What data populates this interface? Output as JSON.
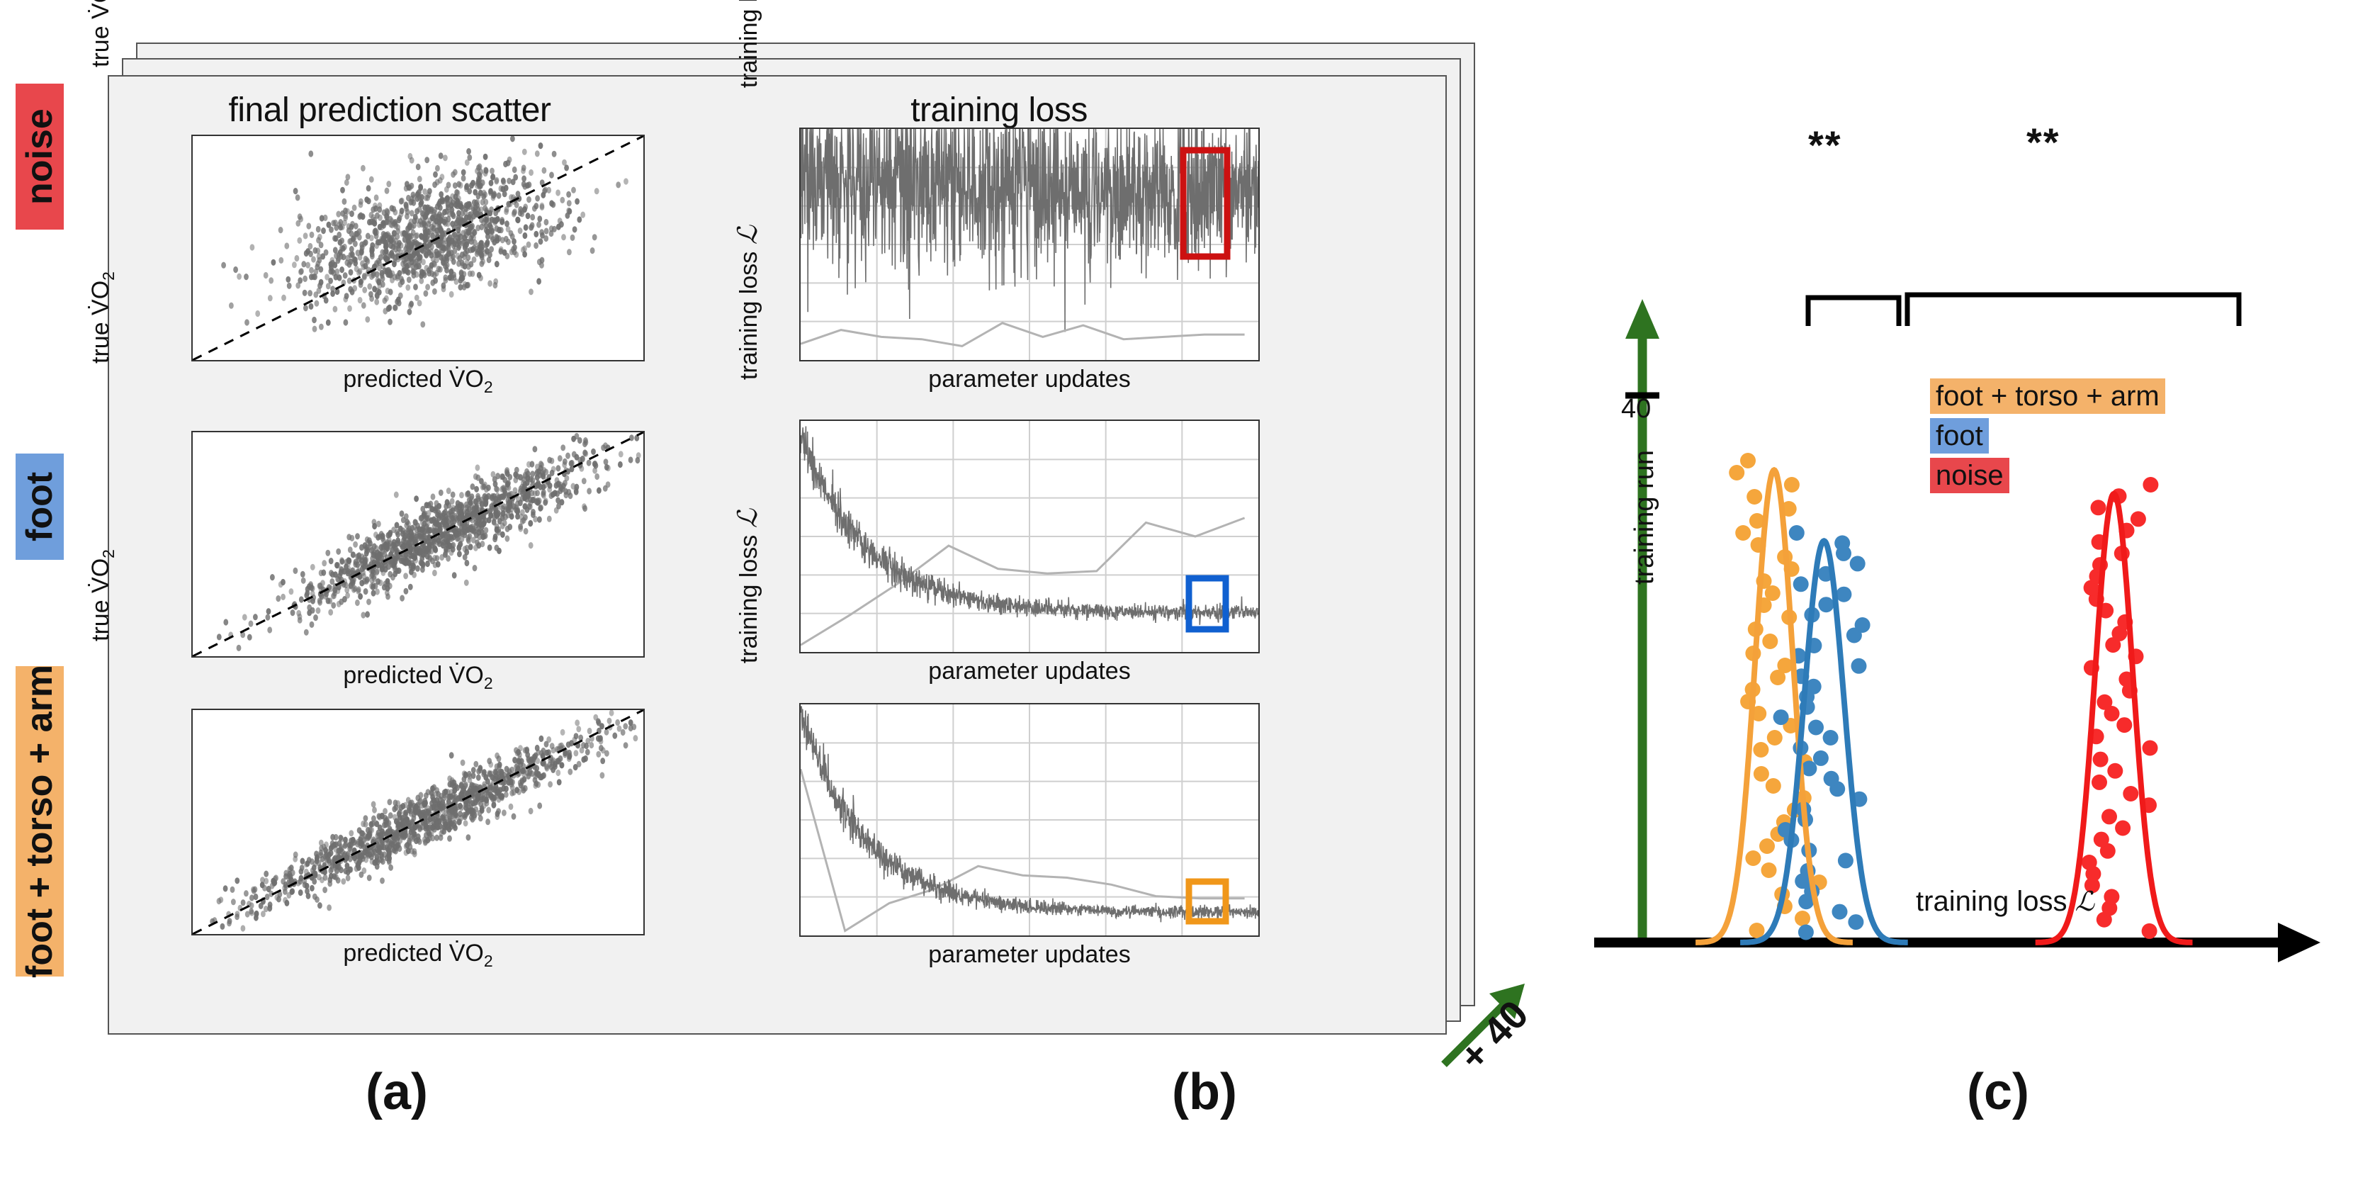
{
  "figure": {
    "panels": [
      {
        "id": "a",
        "label": "(a)"
      },
      {
        "id": "b",
        "label": "(b)"
      },
      {
        "id": "c",
        "label": "(c)"
      }
    ],
    "stack_annotation": "+ 40",
    "stack_annotation_color": "#2e7320"
  },
  "row_labels": [
    {
      "name": "noise",
      "text": "noise",
      "color": "#e8474c"
    },
    {
      "name": "foot",
      "text": "foot",
      "color": "#6f9edc"
    },
    {
      "name": "foot-torso-arm",
      "text": "foot + torso + arm",
      "color": "#f4b26a"
    }
  ],
  "column_headers": {
    "scatter": "final prediction scatter",
    "loss": "training loss"
  },
  "axis_labels": {
    "scatter_y": "true V̇O",
    "scatter_x": "predicted V̇O",
    "scatter_sub": "2",
    "loss_y": "training loss",
    "loss_x": "parameter updates",
    "loss_symbol": "ℒ"
  },
  "highlight_boxes": [
    {
      "row": "noise",
      "color": "#cc1111"
    },
    {
      "row": "foot",
      "color": "#1060d0"
    },
    {
      "row": "foot+torso+arm",
      "color": "#f0971a"
    }
  ],
  "panel_c": {
    "y_axis_label": "training run",
    "y_axis_color": "#2e7320",
    "y_tick_label": "40",
    "x_axis_label": "training loss",
    "x_axis_symbol": "ℒ",
    "significance": [
      {
        "name": "fta-vs-foot",
        "stars": "**"
      },
      {
        "name": "foot-vs-noise",
        "stars": "**"
      }
    ],
    "legend": [
      {
        "label": "foot + torso + arm",
        "color": "#f4b26a"
      },
      {
        "label": "foot",
        "color": "#6f9edc"
      },
      {
        "label": "noise",
        "color": "#e8474c"
      }
    ]
  },
  "chart_data": [
    {
      "type": "scatter",
      "name": "final-prediction-scatter-noise",
      "title": "final prediction scatter",
      "row": "noise",
      "xlabel": "predicted V̇O2",
      "ylabel": "true V̇O2",
      "identity_line": true,
      "point_color": "#6e6e6e",
      "n_points": 1200,
      "cloud": {
        "cx": 0.52,
        "cy": 0.55,
        "sx": 0.14,
        "sy": 0.145,
        "corr": 0.45
      },
      "note": "weak correlation, wide isotropic scatter about the identity line"
    },
    {
      "type": "scatter",
      "name": "final-prediction-scatter-foot",
      "title": "final prediction scatter",
      "row": "foot",
      "xlabel": "predicted V̇O2",
      "ylabel": "true V̇O2",
      "identity_line": true,
      "point_color": "#6e6e6e",
      "n_points": 1200,
      "cloud": {
        "cx": 0.55,
        "cy": 0.55,
        "sx": 0.17,
        "sy": 0.17,
        "corr": 0.9
      },
      "note": "tight elongated cloud hugging the identity line"
    },
    {
      "type": "scatter",
      "name": "final-prediction-scatter-foot-torso-arm",
      "title": "final prediction scatter",
      "row": "foot + torso + arm",
      "xlabel": "predicted V̇O2",
      "ylabel": "true V̇O2",
      "identity_line": true,
      "point_color": "#6e6e6e",
      "n_points": 1200,
      "cloud": {
        "cx": 0.52,
        "cy": 0.52,
        "sx": 0.2,
        "sy": 0.2,
        "corr": 0.955
      },
      "note": "tightest cloud, strongest agreement with identity line"
    },
    {
      "type": "line",
      "name": "training-loss-noise",
      "title": "training loss",
      "row": "noise",
      "xlabel": "parameter updates",
      "ylabel": "training loss ℒ",
      "grid": true,
      "trace_color": "#6e6e6e",
      "val_color": "#b3b3b3",
      "start_level": 0.8,
      "end_level": 0.66,
      "noise_amp": 0.2,
      "highlight_box_color": "#cc1111",
      "val_series": [
        0.07,
        0.13,
        0.1,
        0.09,
        0.06,
        0.16,
        0.1,
        0.15,
        0.09,
        0.1,
        0.11,
        0.11
      ],
      "note": "loss stays high and extremely noisy; barely decreases"
    },
    {
      "type": "line",
      "name": "training-loss-foot",
      "title": "training loss",
      "row": "foot",
      "xlabel": "parameter updates",
      "ylabel": "training loss ℒ",
      "grid": true,
      "trace_color": "#6e6e6e",
      "val_color": "#b3b3b3",
      "start_level": 0.95,
      "end_level": 0.17,
      "noise_amp": 0.06,
      "highlight_box_color": "#1060d0",
      "val_series": [
        0.03,
        0.16,
        0.3,
        0.46,
        0.36,
        0.34,
        0.35,
        0.56,
        0.5,
        0.58
      ],
      "note": "loss decays then plateaus; validation line rises (overfitting)"
    },
    {
      "type": "line",
      "name": "training-loss-foot-torso-arm",
      "title": "training loss",
      "row": "foot + torso + arm",
      "xlabel": "parameter updates",
      "ylabel": "training loss ℒ",
      "grid": true,
      "trace_color": "#6e6e6e",
      "val_color": "#b3b3b3",
      "start_level": 0.96,
      "end_level": 0.1,
      "noise_amp": 0.05,
      "highlight_box_color": "#f0971a",
      "val_series": [
        0.72,
        0.02,
        0.14,
        0.2,
        0.3,
        0.26,
        0.25,
        0.22,
        0.17,
        0.16,
        0.16
      ],
      "note": "fastest decay to the lowest plateau"
    },
    {
      "type": "scatter",
      "name": "final-loss-distributions",
      "title": "",
      "xlabel": "training loss ℒ",
      "ylabel": "training run",
      "ylim": [
        0,
        48
      ],
      "y_ticks": [
        40
      ],
      "distributions": [
        {
          "name": "foot + torso + arm",
          "color": "#f4a13a",
          "mean": 0.175,
          "sigma": 0.03,
          "peak": 40,
          "n": 40
        },
        {
          "name": "foot",
          "color": "#2e7bb8",
          "mean": 0.255,
          "sigma": 0.032,
          "peak": 34,
          "n": 40
        },
        {
          "name": "noise",
          "color": "#f01a1a",
          "mean": 0.72,
          "sigma": 0.03,
          "peak": 38,
          "n": 40
        }
      ],
      "note": "three well-separated Gaussian kernel density curves with jittered run dots"
    }
  ]
}
